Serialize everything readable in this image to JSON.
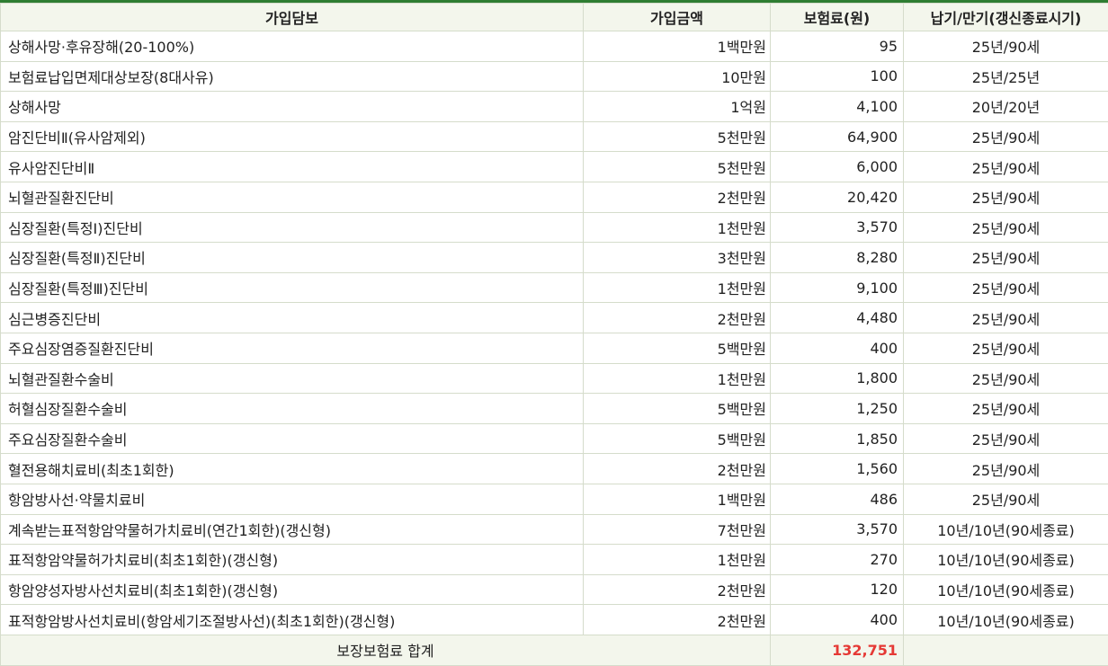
{
  "table": {
    "headers": [
      "가입담보",
      "가입금액",
      "보험료(원)",
      "납기/만기(갱신종료시기)"
    ],
    "rows": [
      [
        "상해사망·후유장해(20-100%)",
        "1백만원",
        "95",
        "25년/90세"
      ],
      [
        "보험료납입면제대상보장(8대사유)",
        "10만원",
        "100",
        "25년/25년"
      ],
      [
        "상해사망",
        "1억원",
        "4,100",
        "20년/20년"
      ],
      [
        "암진단비Ⅱ(유사암제외)",
        "5천만원",
        "64,900",
        "25년/90세"
      ],
      [
        "유사암진단비Ⅱ",
        "5천만원",
        "6,000",
        "25년/90세"
      ],
      [
        "뇌혈관질환진단비",
        "2천만원",
        "20,420",
        "25년/90세"
      ],
      [
        "심장질환(특정Ⅰ)진단비",
        "1천만원",
        "3,570",
        "25년/90세"
      ],
      [
        "심장질환(특정Ⅱ)진단비",
        "3천만원",
        "8,280",
        "25년/90세"
      ],
      [
        "심장질환(특정Ⅲ)진단비",
        "1천만원",
        "9,100",
        "25년/90세"
      ],
      [
        "심근병증진단비",
        "2천만원",
        "4,480",
        "25년/90세"
      ],
      [
        "주요심장염증질환진단비",
        "5백만원",
        "400",
        "25년/90세"
      ],
      [
        "뇌혈관질환수술비",
        "1천만원",
        "1,800",
        "25년/90세"
      ],
      [
        "허혈심장질환수술비",
        "5백만원",
        "1,250",
        "25년/90세"
      ],
      [
        "주요심장질환수술비",
        "5백만원",
        "1,850",
        "25년/90세"
      ],
      [
        "혈전용해치료비(최초1회한)",
        "2천만원",
        "1,560",
        "25년/90세"
      ],
      [
        "항암방사선·약물치료비",
        "1백만원",
        "486",
        "25년/90세"
      ],
      [
        "계속받는표적항암약물허가치료비(연간1회한)(갱신형)",
        "7천만원",
        "3,570",
        "10년/10년(90세종료)"
      ],
      [
        "표적항암약물허가치료비(최초1회한)(갱신형)",
        "1천만원",
        "270",
        "10년/10년(90세종료)"
      ],
      [
        "항암양성자방사선치료비(최초1회한)(갱신형)",
        "2천만원",
        "120",
        "10년/10년(90세종료)"
      ],
      [
        "표적항암방사선치료비(항암세기조절방사선)(최초1회한)(갱신형)",
        "2천만원",
        "400",
        "10년/10년(90세종료)"
      ]
    ],
    "footer": {
      "label": "보장보험료 합계",
      "total": "132,751",
      "blank": ""
    }
  },
  "colors": {
    "accent": "#2e7d32",
    "header_bg": "#f3f6ec",
    "total_text": "#e53935",
    "border": "#d5dccb"
  }
}
